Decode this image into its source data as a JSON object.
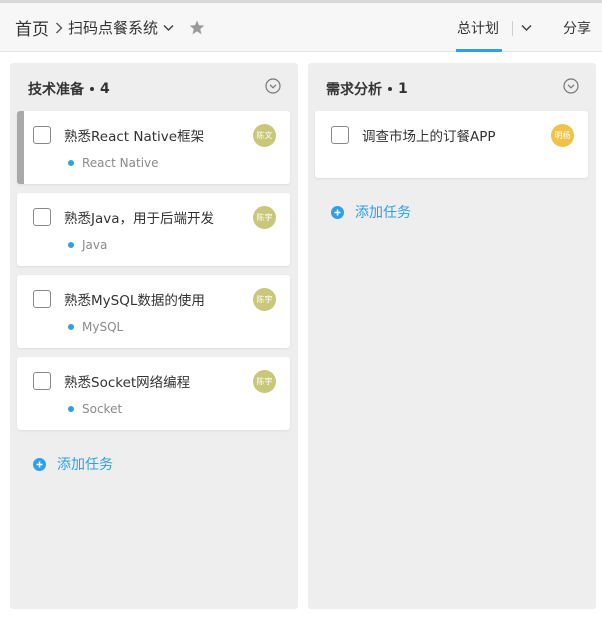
{
  "breadcrumb": {
    "home": "首页",
    "project": "扫码点餐系统"
  },
  "header_tabs": {
    "plan": "总计划",
    "share": "分享"
  },
  "colors": {
    "accent": "#2fa0e6",
    "avatar": "#c8c77b",
    "avatar_alt": "#f0c24a",
    "column_bg": "#eeeeee"
  },
  "columns": [
    {
      "name": "技术准备",
      "count": "4",
      "cards": [
        {
          "title": "熟悉React Native框架",
          "tag": "React Native",
          "avatar": "陈文"
        },
        {
          "title": "熟悉Java，用于后端开发",
          "tag": "Java",
          "avatar": "陈宇"
        },
        {
          "title": "熟悉MySQL数据的使用",
          "tag": "MySQL",
          "avatar": "陈宇"
        },
        {
          "title": "熟悉Socket网络编程",
          "tag": "Socket",
          "avatar": "陈宇"
        }
      ],
      "add_label": "添加任务"
    },
    {
      "name": "需求分析",
      "count": "1",
      "cards": [
        {
          "title": "调查市场上的订餐APP",
          "avatar": "明杨"
        }
      ],
      "add_label": "添加任务"
    }
  ]
}
